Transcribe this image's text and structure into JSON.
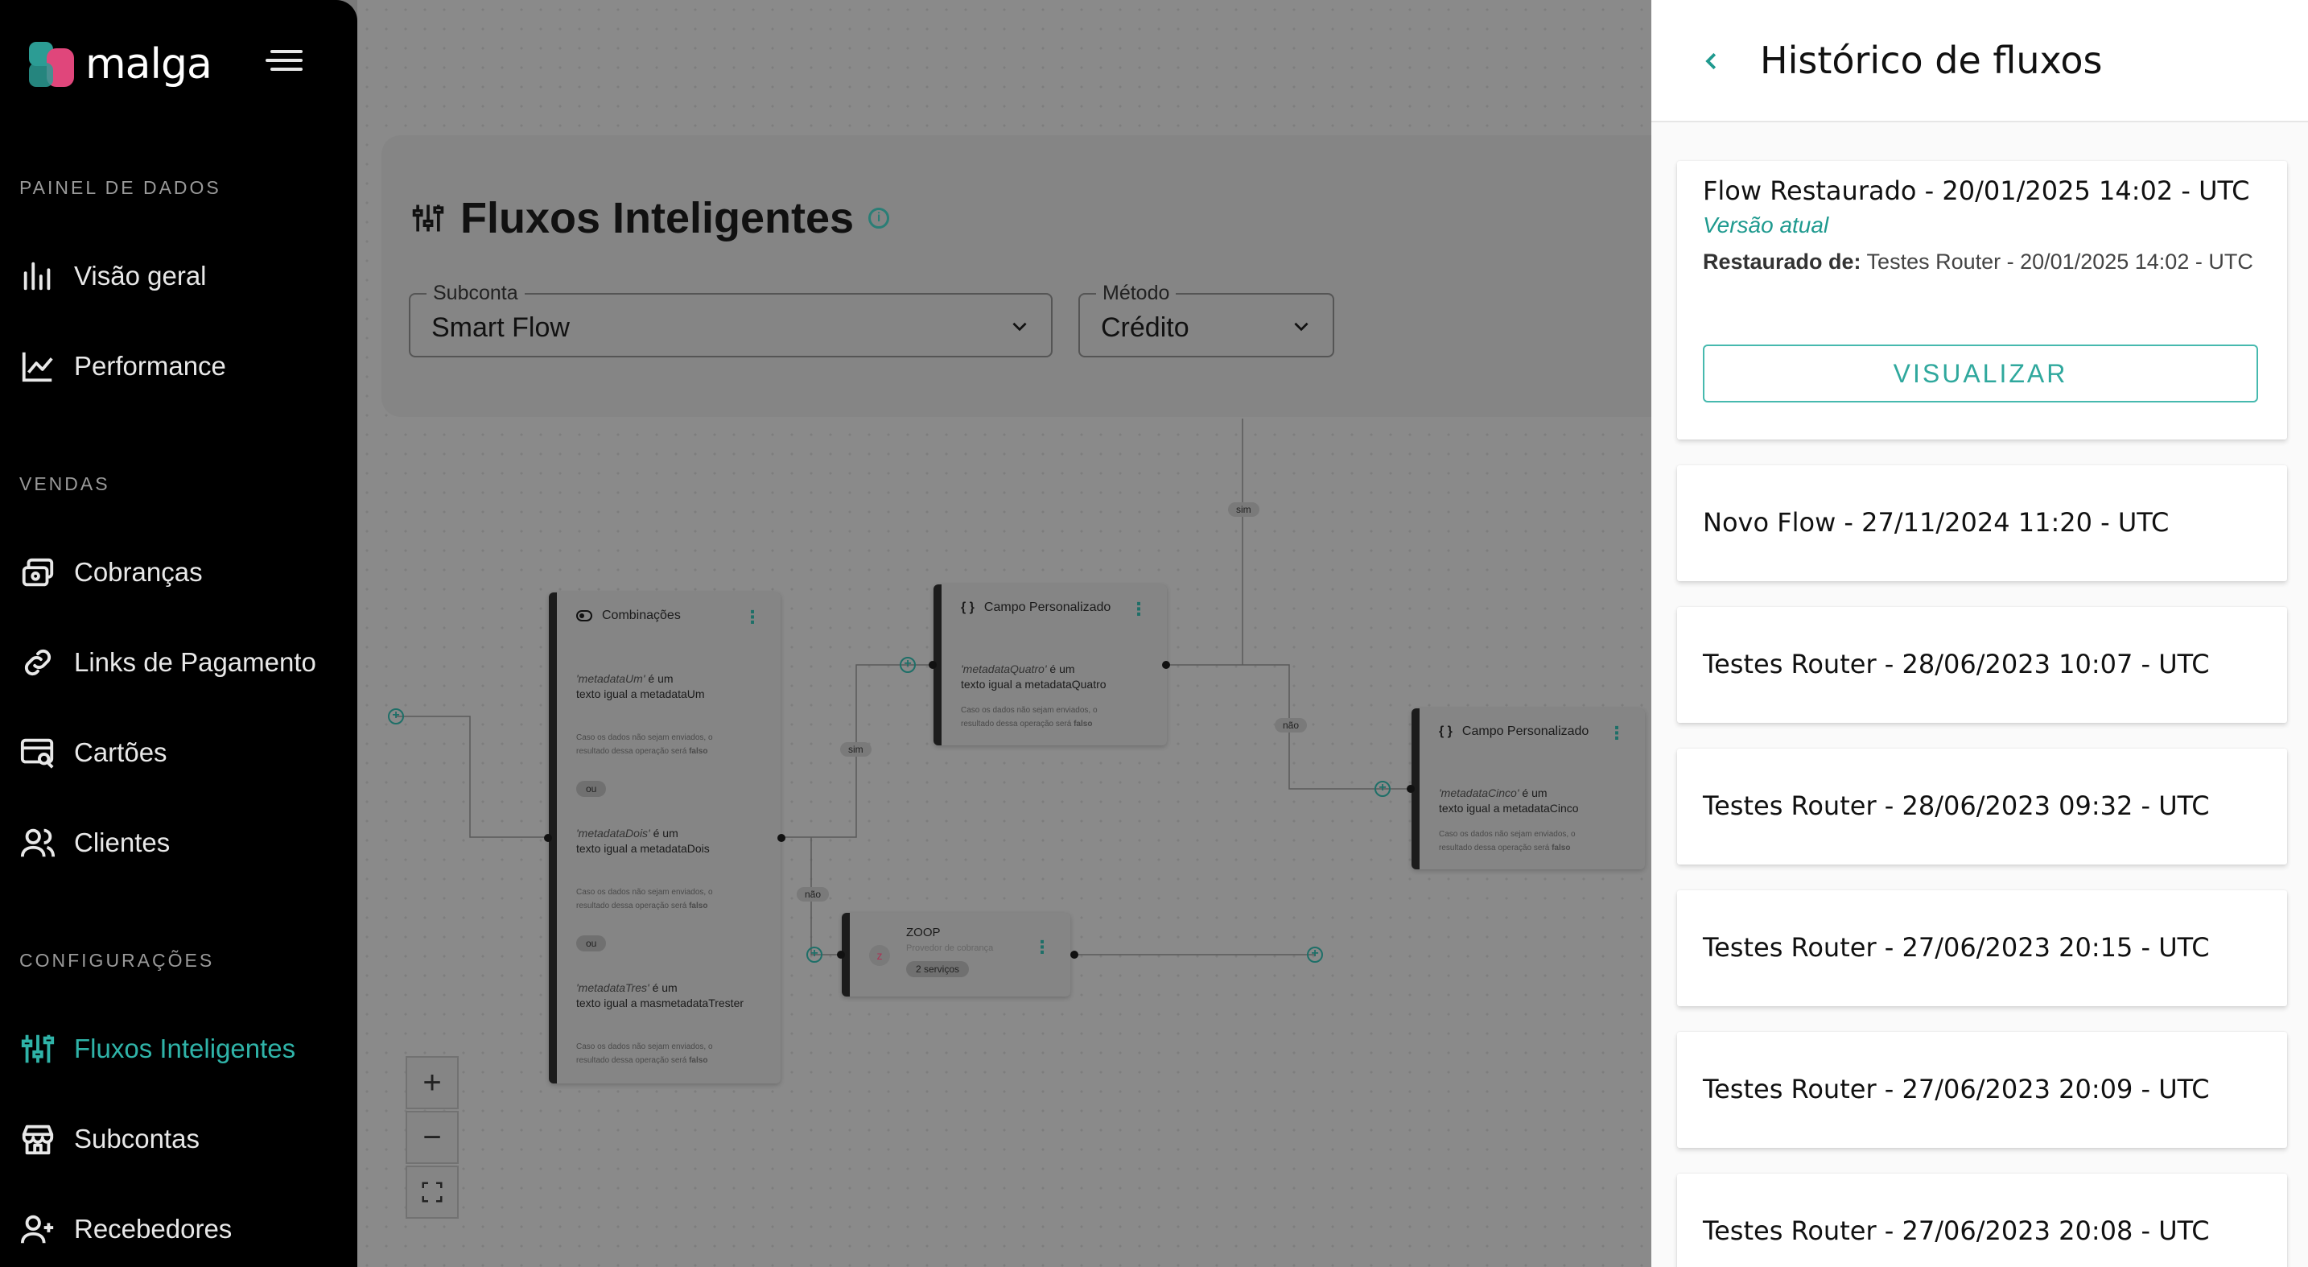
{
  "brand": {
    "name": "malga"
  },
  "sidebar": {
    "sections": [
      {
        "title": "PAINEL DE DADOS"
      },
      {
        "title": "VENDAS"
      },
      {
        "title": "CONFIGURAÇÕES"
      }
    ],
    "items": [
      {
        "label": "Visão geral",
        "icon": "bar-chart-icon"
      },
      {
        "label": "Performance",
        "icon": "line-chart-icon"
      },
      {
        "label": "Cobranças",
        "icon": "charges-icon"
      },
      {
        "label": "Links de Pagamento",
        "icon": "link-icon"
      },
      {
        "label": "Cartões",
        "icon": "card-search-icon"
      },
      {
        "label": "Clientes",
        "icon": "users-icon"
      },
      {
        "label": "Fluxos Inteligentes",
        "icon": "sliders-icon",
        "active": true
      },
      {
        "label": "Subcontas",
        "icon": "store-icon"
      },
      {
        "label": "Recebedores",
        "icon": "user-add-icon"
      }
    ]
  },
  "main": {
    "title": "Fluxos Inteligentes",
    "subaccount": {
      "label": "Subconta",
      "value": "Smart Flow"
    },
    "method": {
      "label": "Método",
      "value": "Crédito"
    }
  },
  "flow": {
    "combinations": {
      "title": "Combinações",
      "conditions": [
        {
          "field": "'metadataUm'",
          "suffix": " é um",
          "rule": "texto igual a metadataUm"
        },
        {
          "field": "'metadataDois'",
          "suffix": " é um",
          "rule": "texto igual a metadataDois"
        },
        {
          "field": "'metadataTres'",
          "suffix": " é um",
          "rule": "texto igual a masmetadataTrester"
        }
      ],
      "note_prefix": "Caso os dados não sejam enviados, o",
      "note_suffix": "resultado dessa operação será",
      "note_value": "falso",
      "or_label": "ou"
    },
    "custom1": {
      "title": "Campo Personalizado",
      "field": "'metadataQuatro'",
      "suffix": " é um",
      "rule": "texto igual a metadataQuatro"
    },
    "custom2": {
      "title": "Campo Personalizado",
      "field": "'metadataCinco'",
      "suffix": " é um",
      "rule": "texto igual a metadataCinco"
    },
    "zoop": {
      "title": "ZOOP",
      "subtitle": "Provedor de cobrança",
      "services": "2 serviços"
    },
    "edges": {
      "yes": "sim",
      "no": "não"
    }
  },
  "zoom": {
    "in": "+",
    "out": "−"
  },
  "history": {
    "title": "Histórico de fluxos",
    "entries": [
      {
        "title": "Flow Restaurado - 20/01/2025 14:02 - UTC",
        "current_label": "Versão atual",
        "restored_label": "Restaurado de:",
        "restored_value": " Testes Router - 20/01/2025 14:02 - UTC",
        "button": "VISUALIZAR"
      },
      {
        "title": "Novo Flow - 27/11/2024 11:20 - UTC"
      },
      {
        "title": "Testes Router - 28/06/2023 10:07 - UTC"
      },
      {
        "title": "Testes Router - 28/06/2023 09:32 - UTC"
      },
      {
        "title": "Testes Router - 27/06/2023 20:15 - UTC"
      },
      {
        "title": "Testes Router - 27/06/2023 20:09 - UTC"
      },
      {
        "title": "Testes Router - 27/06/2023 20:08 - UTC"
      }
    ]
  },
  "colors": {
    "accent": "#2fb3a8",
    "brand_pink": "#e0467b",
    "sidebar_bg": "#000000"
  }
}
